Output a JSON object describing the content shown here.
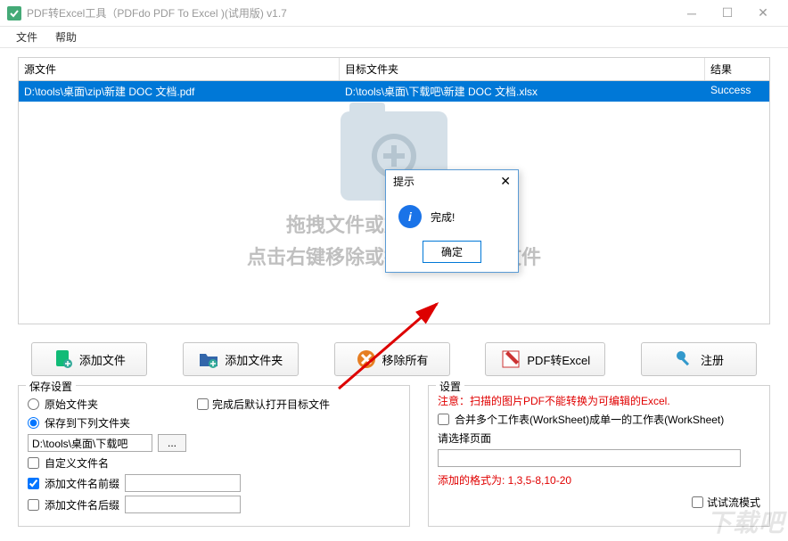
{
  "window": {
    "title": "PDF转Excel工具（PDFdo PDF To Excel )(试用版) v1.7"
  },
  "menu": {
    "file": "文件",
    "help": "帮助"
  },
  "table": {
    "headers": {
      "source": "源文件",
      "dest": "目标文件夹",
      "result": "结果"
    },
    "rows": [
      {
        "source": "D:\\tools\\桌面\\zip\\新建 DOC 文档.pdf",
        "dest": "D:\\tools\\桌面\\下载吧\\新建 DOC 文档.xlsx",
        "result": "Success"
      }
    ]
  },
  "dropHint": {
    "line1": "拖拽文件或文件夹到此处",
    "line2": "点击右键移除或打开表格中的文件"
  },
  "actions": {
    "addFile": "添加文件",
    "addFolder": "添加文件夹",
    "removeAll": "移除所有",
    "convert": "PDF转Excel",
    "register": "注册"
  },
  "saveSettings": {
    "legend": "保存设置",
    "optOriginal": "原始文件夹",
    "optCustom": "保存到下列文件夹",
    "path": "D:\\tools\\桌面\\下载吧",
    "browse": "...",
    "customName": "自定义文件名",
    "addPrefix": "添加文件名前缀",
    "addSuffix": "添加文件名后缀",
    "openAfter": "完成后默认打开目标文件"
  },
  "settings": {
    "legend": "设置",
    "notice": "注意：扫描的图片PDF不能转换为可编辑的Excel.",
    "merge": "合并多个工作表(WorkSheet)成单一的工作表(WorkSheet)",
    "selectPages": "请选择页面",
    "addedFormat": "添加的格式为:  1,3,5-8,10-20",
    "testMode": "试试流模式"
  },
  "modal": {
    "title": "提示",
    "message": "完成!",
    "ok": "确定"
  },
  "watermark": "下载吧"
}
